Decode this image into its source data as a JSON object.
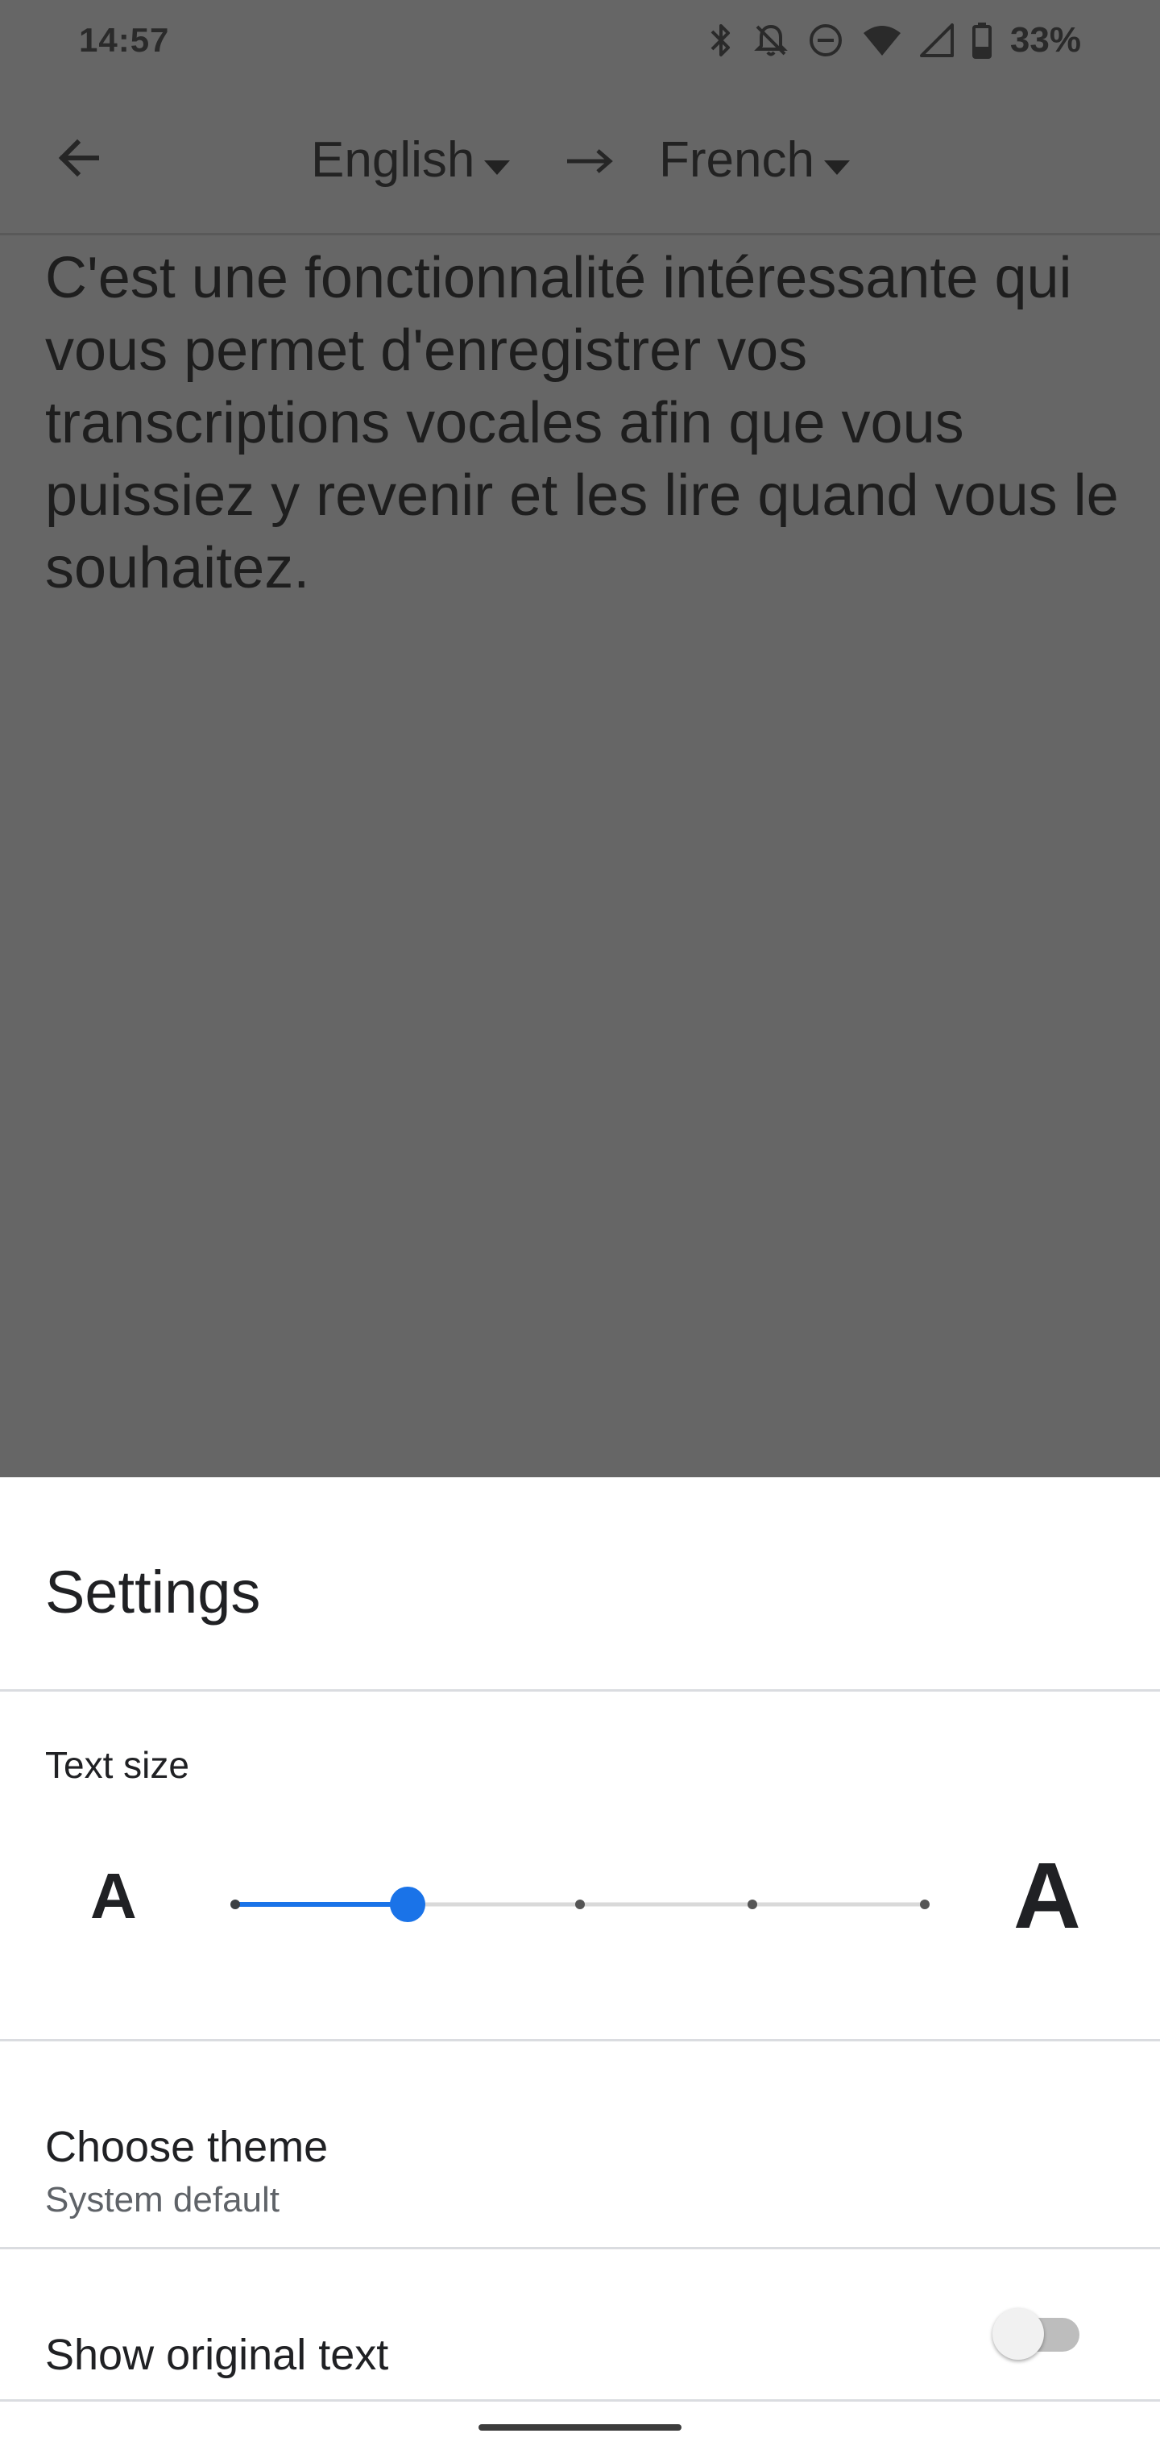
{
  "status_bar": {
    "time": "14:57",
    "battery_percent": "33%",
    "icons": [
      "bluetooth-icon",
      "notifications-off-icon",
      "do-not-disturb-icon",
      "wifi-icon",
      "cellular-signal-icon",
      "battery-icon"
    ]
  },
  "toolbar": {
    "back_icon": "arrow-back-icon",
    "source_language": "English",
    "target_language": "French",
    "direction_icon": "arrow-right-icon"
  },
  "translation": {
    "text": "C'est une fonctionnalité intéressante qui vous permet d'enregistrer vos transcriptions vocales afin que vous puissiez y revenir et les lire quand vous le souhaitez."
  },
  "settings": {
    "title": "Settings",
    "text_size": {
      "label": "Text size",
      "small_glyph": "A",
      "large_glyph": "A",
      "steps": 5,
      "selected_index": 1,
      "accent_color": "#1a73e8"
    },
    "theme": {
      "title": "Choose theme",
      "value": "System default"
    },
    "show_original": {
      "title": "Show original text",
      "enabled": false
    }
  }
}
